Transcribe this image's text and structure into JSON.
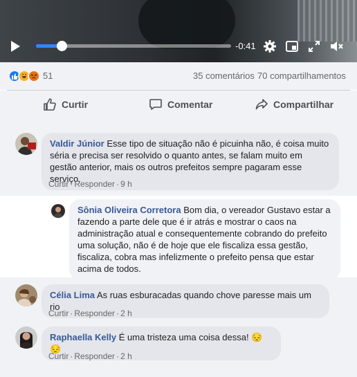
{
  "video": {
    "time_remaining": "-0:41",
    "progress": 0.13
  },
  "reactions": {
    "icons": [
      "like-icon",
      "haha-icon",
      "angry-icon"
    ],
    "count": "51",
    "comments": "35 comentários",
    "shares": "70 compartilhamentos"
  },
  "actions": {
    "like": "Curtir",
    "comment": "Comentar",
    "share": "Compartilhar"
  },
  "comments": [
    {
      "author": "Valdir Júnior",
      "text": "Esse tipo de situação não é picuinha não, é coisa muito séria e precisa ser resolvido o quanto antes, se falam muito em gestão anterior, mais os outros prefeitos sempre pagaram esse serviço.",
      "like": "Curtir",
      "reply": "Responder",
      "time": "9 h"
    },
    {
      "author": "Sônia Oliveira Corretora",
      "text": "Bom dia, o vereador Gustavo estar a fazendo a parte dele que é ir atrás e mostrar o caos na administração atual e consequentemente cobrando do prefeito uma solução, não é de hoje que ele fiscaliza essa gestão, fiscaliza, cobra mas infelizmente o prefeito pensa que estar acima de todos."
    },
    {
      "author": "Célia Lima",
      "text": "As ruas esburacadas quando chove paresse mais um rio",
      "like": "Curtir",
      "reply": "Responder",
      "time": "2 h"
    },
    {
      "author": "Raphaella Kelly",
      "text": "É uma tristeza uma coisa dessa! 😔😔",
      "like": "Curtir",
      "reply": "Responder",
      "time": "2 h"
    }
  ],
  "colors": {
    "accent": "#2d88ff",
    "author": "#385898",
    "bubble": "#e4e6eb",
    "panel": "#f0f2f5"
  }
}
